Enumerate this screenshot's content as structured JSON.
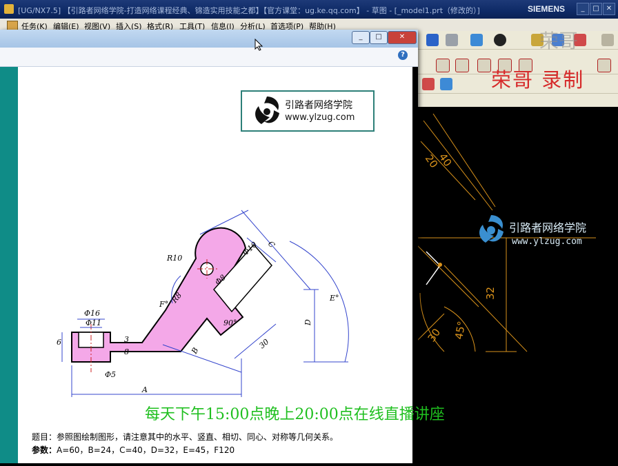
{
  "window": {
    "title": "[UG/NX7.5]  【引路者网络学院-打造网络课程经典、锦造实用技能之都】【官方课堂：ug.ke.qq.com】 - 草图 - [_model1.prt（修改的）]",
    "brand": "SIEMENS",
    "controls": [
      "_",
      "□",
      "✕"
    ]
  },
  "menubar": {
    "items": [
      "任务(K)",
      "编辑(E)",
      "视图(V)",
      "插入(S)",
      "格式(R)",
      "工具(T)",
      "信息(I)",
      "分析(L)",
      "首选项(P)",
      "帮助(H)"
    ]
  },
  "dialog": {
    "controls": [
      "_",
      "□",
      "✕"
    ],
    "help": "?",
    "logo": {
      "name": "引路者网络学院",
      "url": "www.ylzug.com"
    },
    "problem_text": "题目：参照图绘制图形，请注意其中的水平、竖直、相切、同心、对称等几何关系。",
    "params_label": "参数：",
    "params_text": "A=60，B=24，C=40，D=32，E=45，F120"
  },
  "drawing": {
    "dims": [
      "C",
      "Φ10",
      "R10",
      "Φ8",
      "R8",
      "F°",
      "90°",
      "E°",
      "D",
      "30",
      "B",
      "Φ16",
      "Φ11",
      "6",
      "3",
      "8",
      "Φ5",
      "A"
    ],
    "fill": "#f4a8e8"
  },
  "cad": {
    "dims": [
      "40",
      "20",
      "32",
      "30",
      "45°"
    ],
    "logo": {
      "name": "引路者网络学院",
      "url": "www.ylzug.com"
    }
  },
  "overlay": {
    "red_watermark": "荣哥  录制",
    "banner": "每天下午15:00点晚上20:00点在线直播讲座"
  },
  "colors": {
    "teal": "#0f8c87",
    "dim_line": "#3344cc",
    "cad_dim": "#d9921b",
    "banner": "#1fbf1f",
    "watermark": "#d62a2a"
  }
}
